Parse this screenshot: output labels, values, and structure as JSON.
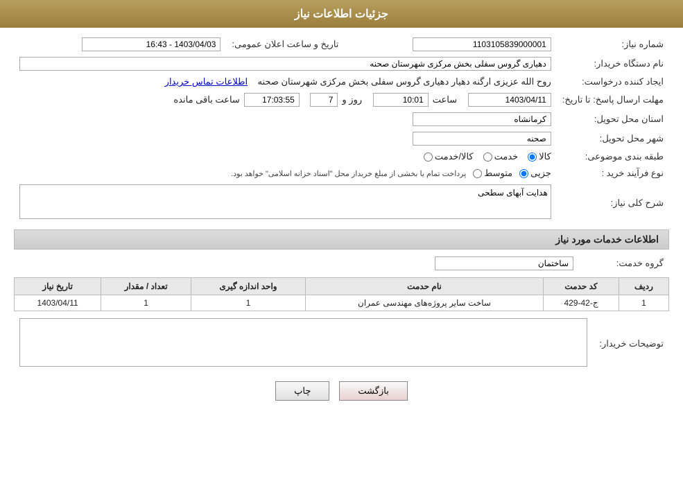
{
  "header": {
    "title": "جزئیات اطلاعات نیاز"
  },
  "fields": {
    "need_number_label": "شماره نیاز:",
    "need_number_value": "1103105839000001",
    "announce_date_label": "تاریخ و ساعت اعلان عمومی:",
    "announce_date_value": "1403/04/03 - 16:43",
    "buyer_name_label": "نام دستگاه خریدار:",
    "buyer_name_value": "دهیاری گروس سفلی بخش مرکزی شهرستان صحنه",
    "creator_label": "ایجاد کننده درخواست:",
    "creator_value": "روح الله عزیزی ارگنه دهیار دهیاری گروس سفلی بخش مرکزی شهرستان صحنه",
    "contact_link": "اطلاعات تماس خریدار",
    "response_deadline_label": "مهلت ارسال پاسخ: تا تاریخ:",
    "response_date": "1403/04/11",
    "response_time_label": "ساعت",
    "response_time": "10:01",
    "response_day_label": "روز و",
    "response_day": "7",
    "response_remaining_label": "ساعت باقی مانده",
    "response_remaining": "17:03:55",
    "province_label": "استان محل تحویل:",
    "province_value": "کرمانشاه",
    "city_label": "شهر محل تحویل:",
    "city_value": "صحنه",
    "category_label": "طبقه بندی موضوعی:",
    "category_options": [
      {
        "label": "کالا",
        "value": "kala",
        "checked": true
      },
      {
        "label": "خدمت",
        "value": "khedmat",
        "checked": false
      },
      {
        "label": "کالا/خدمت",
        "value": "kala_khedmat",
        "checked": false
      }
    ],
    "proc_type_label": "نوع فرآیند خرید :",
    "proc_type_options": [
      {
        "label": "جزیی",
        "value": "jozi",
        "checked": true
      },
      {
        "label": "متوسط",
        "value": "motavaset",
        "checked": false
      }
    ],
    "proc_type_note": "پرداخت تمام یا بخشی از مبلغ خریداز محل \"اسناد خزانه اسلامی\" خواهد بود.",
    "need_desc_label": "شرح کلی نیاز:",
    "need_desc_value": "هدایت آبهای سطحی",
    "services_section_label": "اطلاعات خدمات مورد نیاز",
    "service_group_label": "گروه خدمت:",
    "service_group_value": "ساختمان",
    "table_headers": {
      "row_num": "ردیف",
      "service_code": "کد حدمت",
      "service_name": "نام حدمت",
      "unit": "واحد اندازه گیری",
      "quantity": "تعداد / مقدار",
      "date": "تاریخ نیاز"
    },
    "table_rows": [
      {
        "row_num": "1",
        "service_code": "ج-42-429",
        "service_name": "ساخت سایر پروژه‌های مهندسی عمران",
        "unit": "1",
        "quantity": "1",
        "date": "1403/04/11"
      }
    ],
    "buyer_desc_label": "توضیحات خریدار:",
    "buyer_desc_value": ""
  },
  "buttons": {
    "print_label": "چاپ",
    "back_label": "بازگشت"
  }
}
